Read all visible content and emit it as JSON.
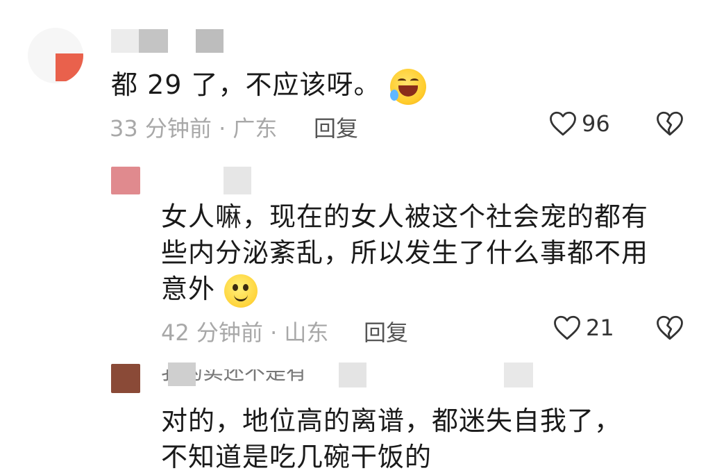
{
  "comments": [
    {
      "text": "都 29 了，不应该呀。",
      "emoji": "rofl-emoji",
      "time": "33 分钟前",
      "location": "· 广东",
      "reply_label": "回复",
      "likes": "96"
    },
    {
      "text_line1": "女人嘛，现在的女人被这个社会宠的都有",
      "text_line2": "些内分泌紊乱，所以发生了什么事都不用",
      "text_line3": "意外",
      "emoji": "dazed-smile-emoji",
      "time": "42 分钟前",
      "location": "· 山东",
      "reply_label": "回复",
      "likes": "21"
    },
    {
      "quoted_text": "我的实还不是有",
      "text_line1": "对的，地位高的离谱，都迷失自我了，",
      "text_line2": "不知道是吃几碗干饭的"
    }
  ],
  "colors": {
    "avatar_top": "#e9614c",
    "avatar_reply1": "#e08a8e",
    "avatar_reply2": "#8a4a37",
    "text": "#1a1a1a",
    "meta": "#a8a8a8"
  },
  "icons": [
    "heart-outline-icon",
    "broken-heart-icon"
  ]
}
